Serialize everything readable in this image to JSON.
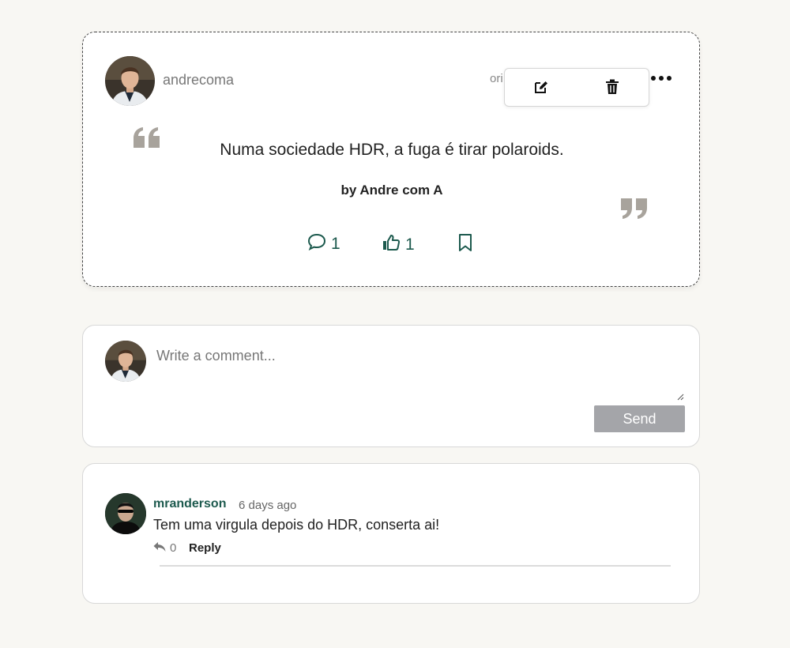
{
  "quote": {
    "author": "andrecoma",
    "origin_fragment": "ori",
    "text": "Numa sociedade HDR, a fuga é tirar polaroids.",
    "byline": "by Andre com A",
    "comments_count": "1",
    "likes_count": "1",
    "icons": [
      "edit-icon",
      "trash-icon",
      "more-icon",
      "comment-icon",
      "thumbs-up-icon",
      "bookmark-icon",
      "quote-open-icon",
      "quote-close-icon"
    ]
  },
  "composer": {
    "placeholder": "Write a comment...",
    "value": "",
    "send_label": "Send"
  },
  "comments": [
    {
      "user": "mranderson",
      "time": "6 days ago",
      "body": "Tem uma virgula depois do HDR, conserta ai!",
      "reply_count": "0",
      "reply_label": "Reply"
    }
  ],
  "colors": {
    "accent": "#1d5a4e",
    "background": "#f8f7f3",
    "send_button": "#a4a5a9",
    "quote_marks": "#a8a39c"
  }
}
